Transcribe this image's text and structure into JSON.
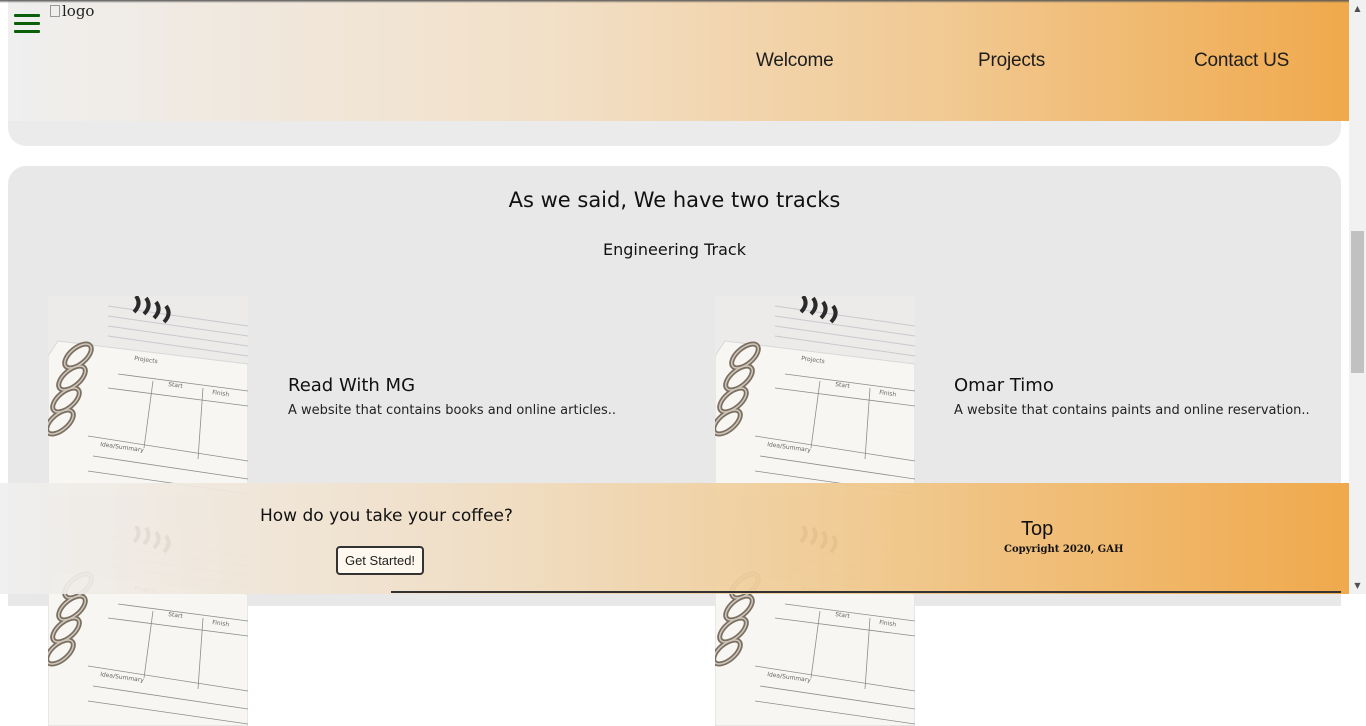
{
  "header": {
    "logo_alt": "logo",
    "nav": [
      "Welcome",
      "Projects",
      "Contact US"
    ]
  },
  "tracks": {
    "title": "As we said, We have two tracks",
    "subtitle": "Engineering Track",
    "cards": [
      {
        "title": "Read With MG",
        "description": "A website that contains books and online articles.."
      },
      {
        "title": "Omar Timo",
        "description": "A website that contains paints and online reservation.."
      }
    ]
  },
  "footer": {
    "question": "How do you take your coffee?",
    "button": "Get Started!",
    "top_link": "Top",
    "copyright": "Copyright 2020, GAH"
  },
  "colors": {
    "header_gradient_end": "#f0a94c",
    "section_bg": "#e9e8e9",
    "hamburger": "#0b5f0b"
  }
}
